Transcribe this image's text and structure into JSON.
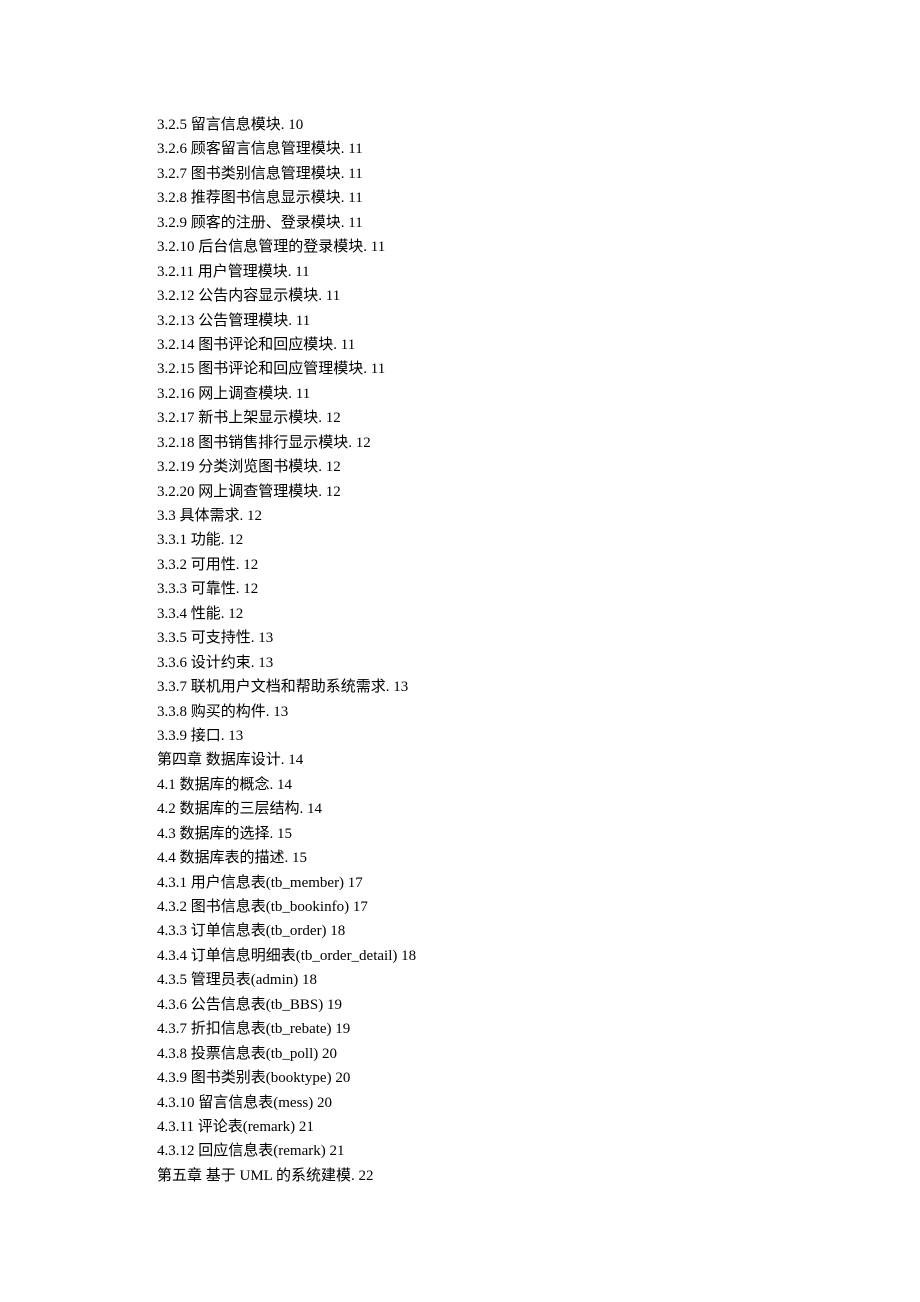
{
  "entries": [
    "3.2.5  留言信息模块. 10",
    "3.2.6  顾客留言信息管理模块. 11",
    "3.2.7  图书类别信息管理模块. 11",
    "3.2.8  推荐图书信息显示模块. 11",
    "3.2.9  顾客的注册、登录模块. 11",
    "3.2.10  后台信息管理的登录模块. 11",
    "3.2.11  用户管理模块. 11",
    "3.2.12  公告内容显示模块. 11",
    "3.2.13  公告管理模块. 11",
    "3.2.14  图书评论和回应模块. 11",
    "3.2.15  图书评论和回应管理模块. 11",
    "3.2.16  网上调查模块. 11",
    "3.2.17  新书上架显示模块. 12",
    "3.2.18  图书销售排行显示模块. 12",
    "3.2.19  分类浏览图书模块. 12",
    "3.2.20  网上调查管理模块. 12",
    "3.3   具体需求. 12",
    "3.3.1   功能. 12",
    "3.3.2   可用性. 12",
    "3.3.3   可靠性. 12",
    "3.3.4   性能. 12",
    "3.3.5   可支持性. 13",
    "3.3.6   设计约束. 13",
    "3.3.7   联机用户文档和帮助系统需求. 13",
    "3.3.8   购买的构件. 13",
    "3.3.9   接口. 13",
    "第四章  数据库设计. 14",
    "4.1  数据库的概念. 14",
    "4.2  数据库的三层结构. 14",
    "4.3  数据库的选择. 15",
    "4.4  数据库表的描述. 15",
    "4.3.1  用户信息表(tb_member) 17",
    "4.3.2  图书信息表(tb_bookinfo) 17",
    "4.3.3  订单信息表(tb_order) 18",
    "4.3.4  订单信息明细表(tb_order_detail) 18",
    "4.3.5  管理员表(admin) 18",
    "4.3.6  公告信息表(tb_BBS) 19",
    "4.3.7  折扣信息表(tb_rebate) 19",
    "4.3.8  投票信息表(tb_poll) 20",
    "4.3.9  图书类别表(booktype) 20",
    "4.3.10  留言信息表(mess) 20",
    "4.3.11  评论表(remark) 21",
    "4.3.12  回应信息表(remark) 21",
    "第五章  基于 UML 的系统建模. 22"
  ]
}
